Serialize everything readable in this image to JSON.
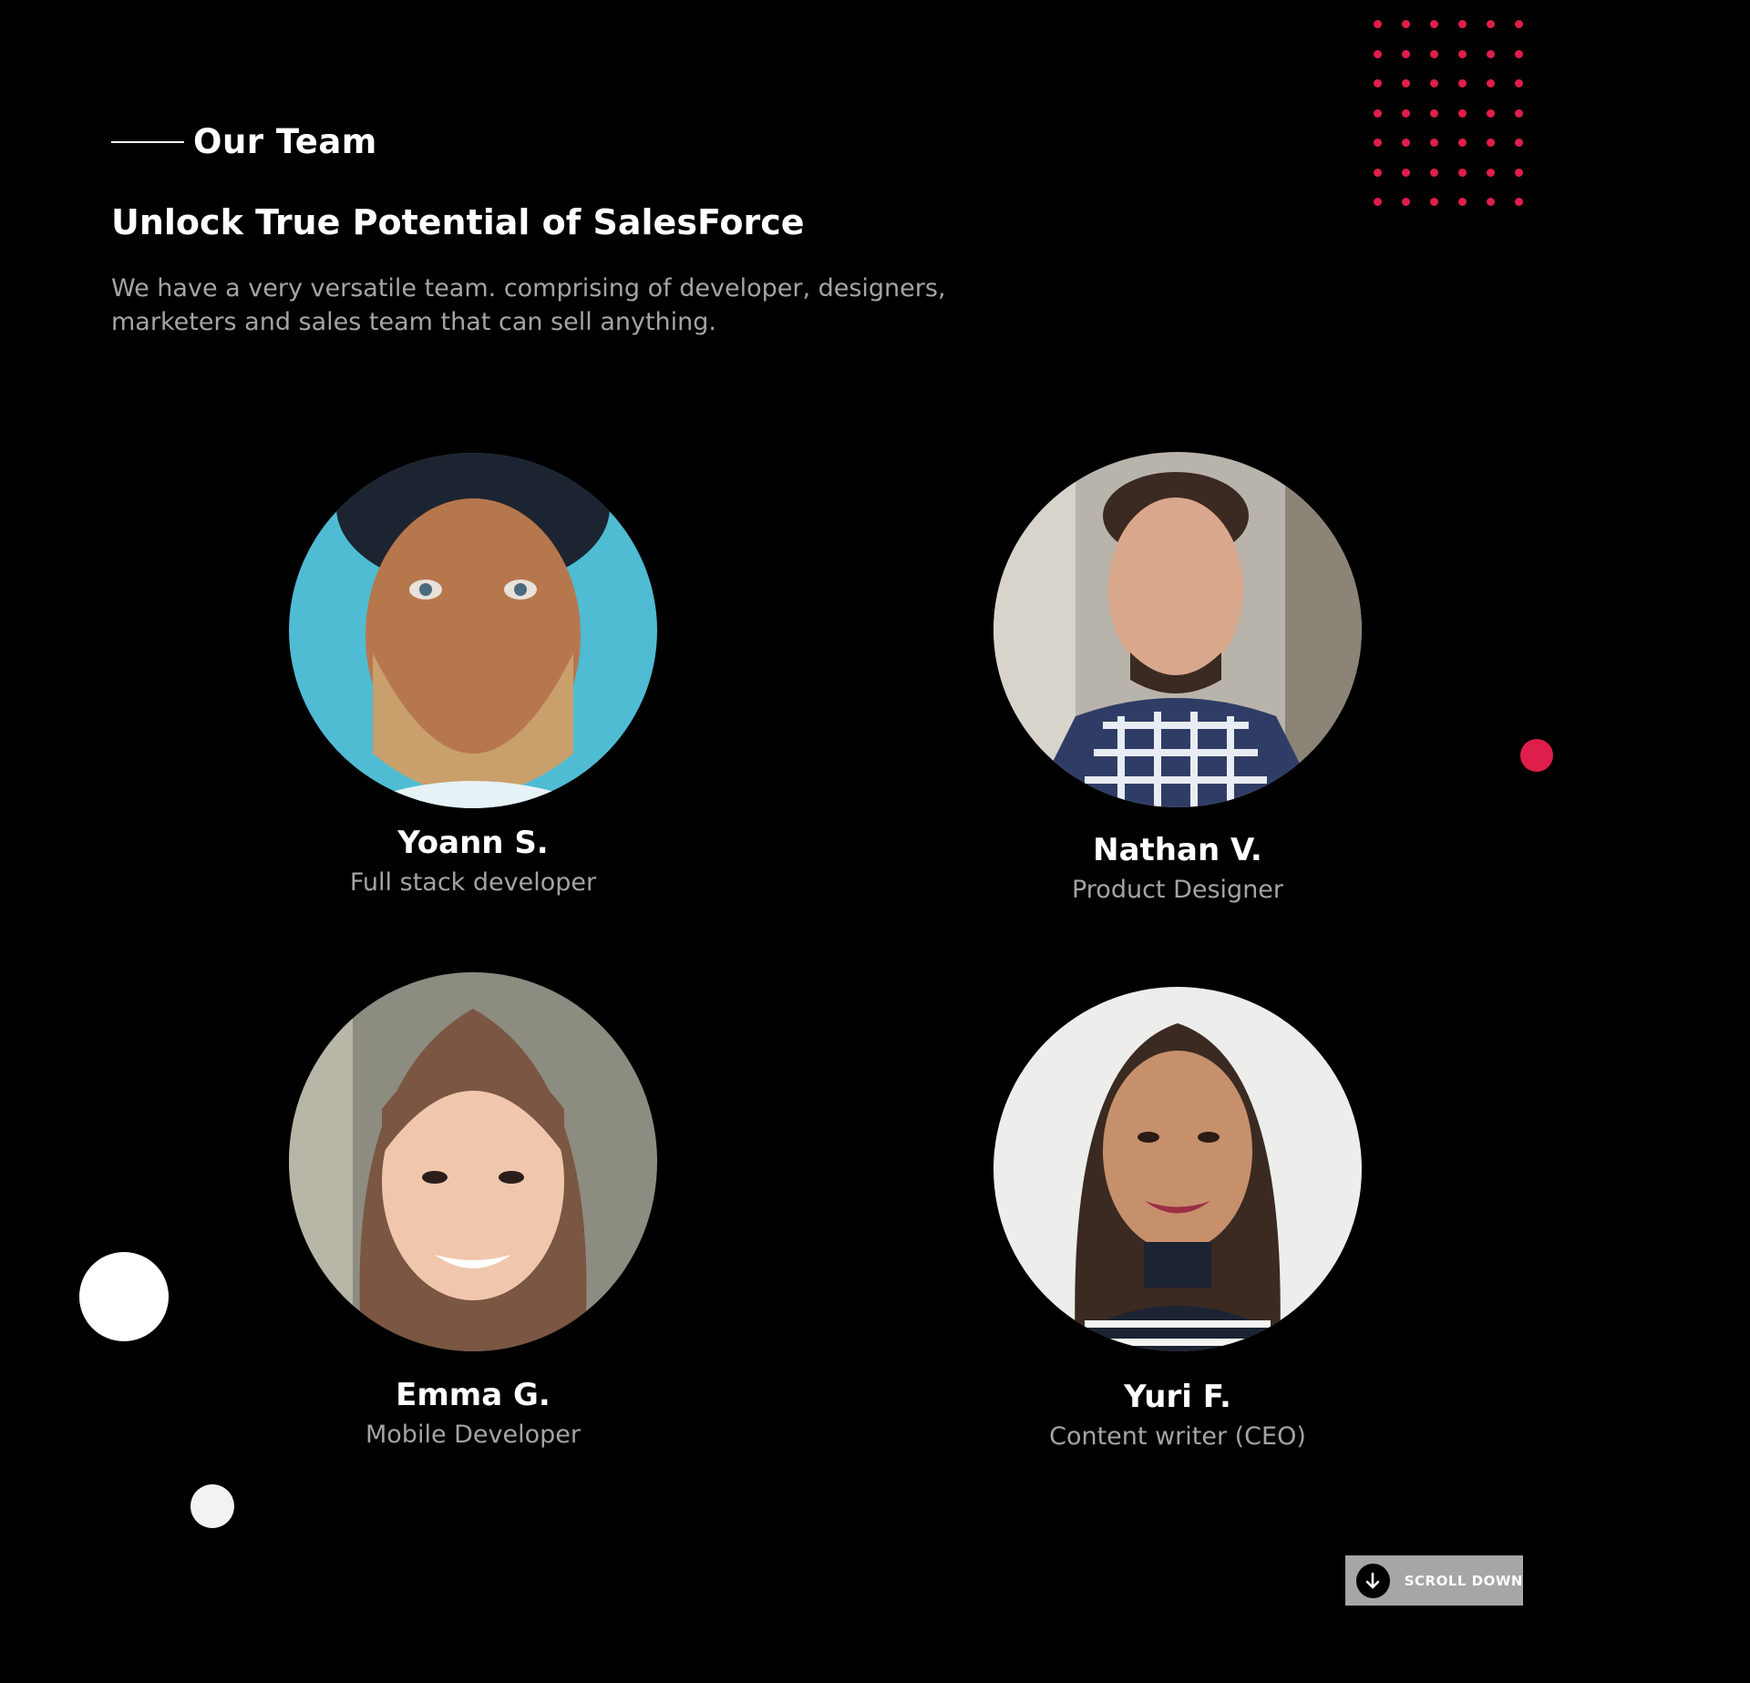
{
  "section": {
    "label": "Our Team",
    "headline": "Unlock True Potential of SalesForce",
    "intro": "We have a very versatile team. comprising of developer, designers, marketers and sales team that can sell anything."
  },
  "team": [
    {
      "name": "Yoann S.",
      "role": "Full stack developer",
      "photo": "portrait-bearded-man-cap"
    },
    {
      "name": "Nathan V.",
      "role": "Product Designer",
      "photo": "portrait-man-plaid-shirt"
    },
    {
      "name": "Emma G.",
      "role": "Mobile Developer",
      "photo": "portrait-woman-bangs"
    },
    {
      "name": "Yuri F.",
      "role": "Content writer (CEO)",
      "photo": "portrait-woman-long-hair"
    }
  ],
  "scroll": {
    "label": "SCROLL DOWN",
    "icon": "arrow-down-icon"
  },
  "colors": {
    "background": "#000000",
    "accent": "#e01e4b",
    "text": "#ffffff",
    "muted": "#a4a4a4",
    "button": "#a6a6a6"
  }
}
